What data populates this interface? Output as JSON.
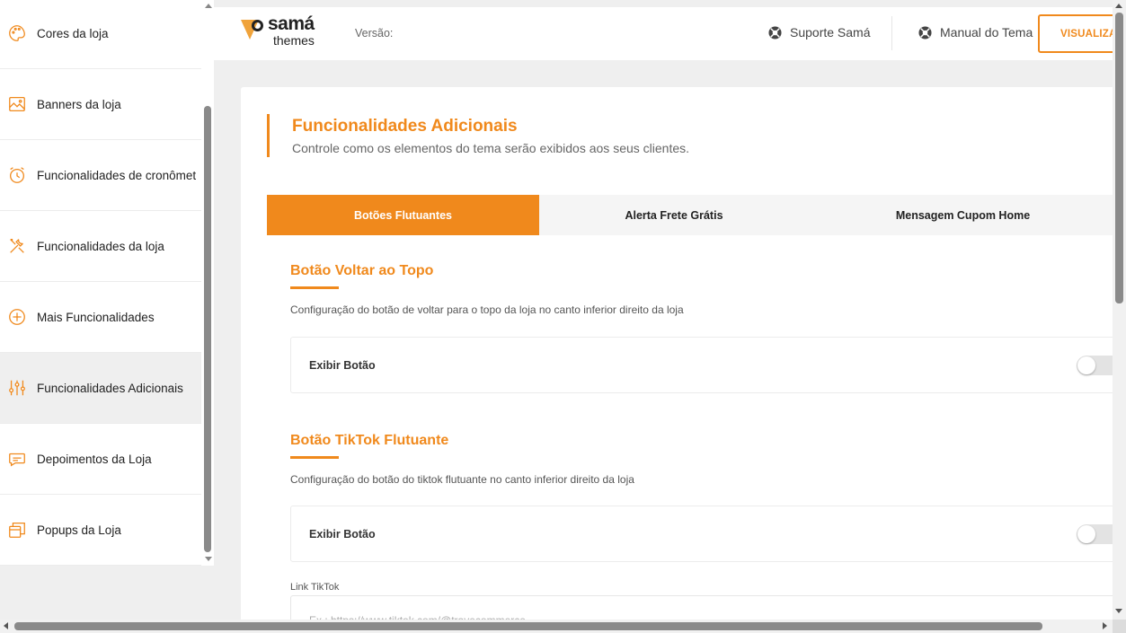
{
  "sidebar": {
    "items": [
      {
        "label": "Cores da loja",
        "icon": "palette-icon"
      },
      {
        "label": "Banners da loja",
        "icon": "image-icon"
      },
      {
        "label": "Funcionalidades de cronômet",
        "icon": "alarm-clock-icon"
      },
      {
        "label": "Funcionalidades da loja",
        "icon": "tools-icon"
      },
      {
        "label": "Mais Funcionalidades",
        "icon": "plus-circle-icon"
      },
      {
        "label": "Funcionalidades Adicionais",
        "icon": "sliders-icon",
        "active": true
      },
      {
        "label": "Depoimentos da Loja",
        "icon": "chat-bubble-icon"
      },
      {
        "label": "Popups da Loja",
        "icon": "window-stack-icon"
      }
    ]
  },
  "header": {
    "logo": {
      "line1": "samá",
      "line2": "themes"
    },
    "version_label": "Versão:",
    "links": [
      {
        "label": "Suporte Samá",
        "icon": "lifebuoy-icon"
      },
      {
        "label": "Manual do Tema",
        "icon": "lifebuoy-icon"
      }
    ],
    "preview_button": "VISUALIZAR"
  },
  "main": {
    "title": "Funcionalidades Adicionais",
    "subtitle": "Controle como os elementos do tema serão exibidos aos seus clientes.",
    "tabs": [
      {
        "label": "Botões Flutuantes",
        "active": true
      },
      {
        "label": "Alerta Frete Grátis",
        "active": false
      },
      {
        "label": "Mensagem Cupom Home",
        "active": false
      }
    ],
    "sections": [
      {
        "title": "Botão Voltar ao Topo",
        "description": "Configuração do botão de voltar para o topo da loja no canto inferior direito da loja",
        "option_label": "Exibir Botão",
        "enabled": false
      },
      {
        "title": "Botão TikTok Flutuante",
        "description": "Configuração do botão do tiktok flutuante no canto inferior direito da loja",
        "option_label": "Exibir Botão",
        "enabled": false,
        "field_label": "Link TikTok",
        "field_placeholder": "Ex.: https://www.tiktok.com/@travecommerce",
        "field_value": ""
      }
    ]
  },
  "colors": {
    "accent": "#f0891c",
    "logo_triangle": "#f0a33a",
    "background": "#efefef"
  }
}
